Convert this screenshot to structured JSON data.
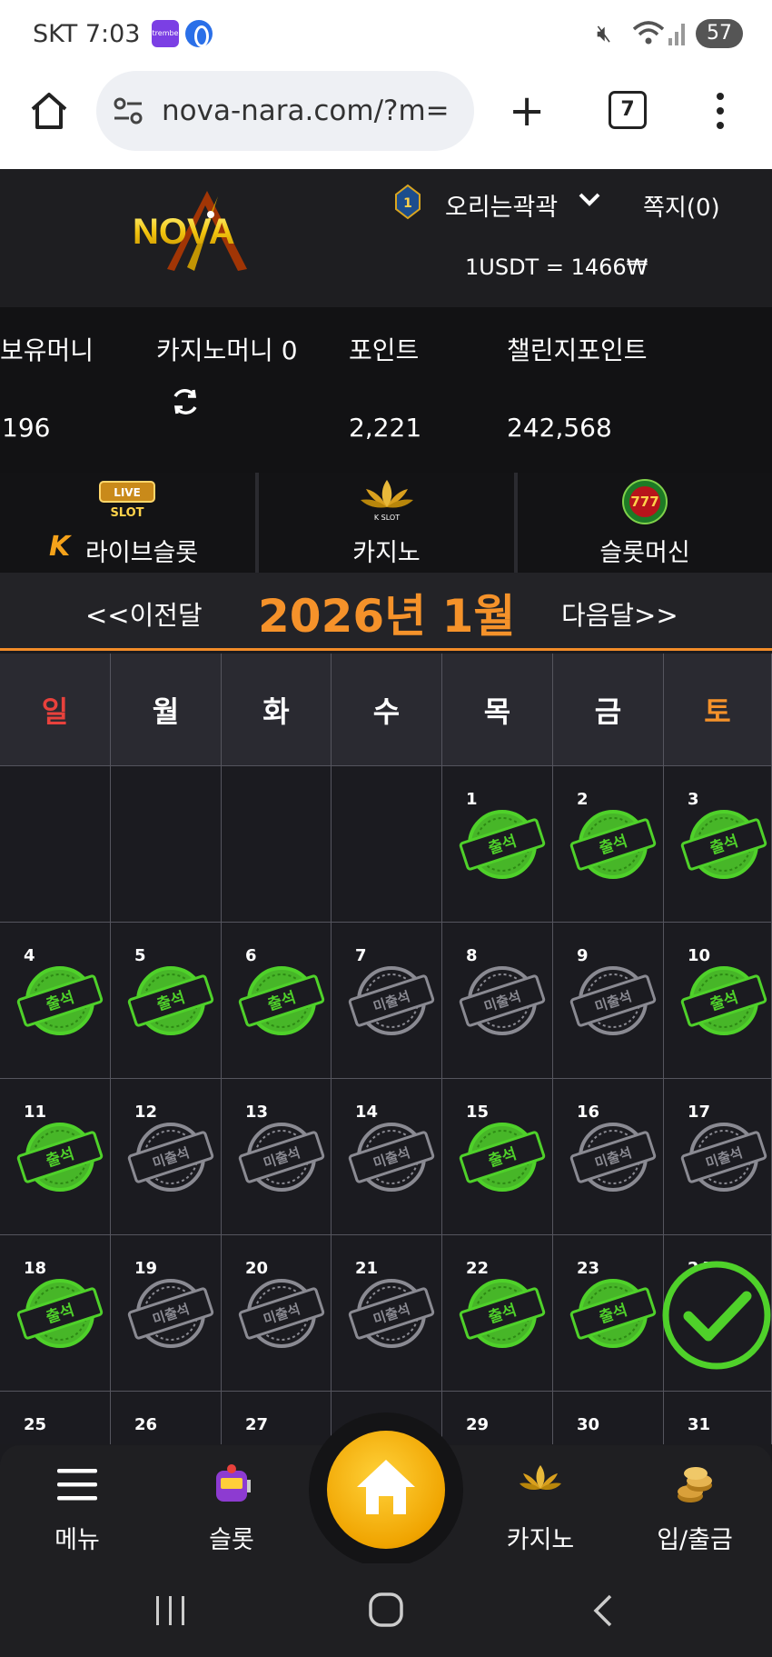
{
  "status_bar": {
    "carrier_time": "SKT 7:03",
    "app_icon_label": "trembe",
    "battery": "57"
  },
  "browser": {
    "url": "nova-nara.com/?m=",
    "tab_count": "7"
  },
  "header": {
    "logo_text": "NOVA",
    "level": "1",
    "username": "오리는곽곽",
    "messages": "쪽지(0)",
    "rate": "1USDT = 1466₩"
  },
  "balances": {
    "money_label": "보유머니",
    "money_value": "196",
    "casino_label": "카지노머니 0",
    "point_label": "포인트",
    "point_value": "2,221",
    "challenge_label": "챌린지포인트",
    "challenge_value": "242,568"
  },
  "categories": [
    {
      "label": "라이브슬롯",
      "icon": "live-slot-icon",
      "badge": "LIVE",
      "sub": "SLOT"
    },
    {
      "label": "카지노",
      "icon": "k-slot-lotus-icon",
      "sub": "K SLOT"
    },
    {
      "label": "슬롯머신",
      "icon": "777-slots-icon",
      "sub": "777"
    }
  ],
  "month_nav": {
    "prev": "<<이전달",
    "title": "2026년 1월",
    "next": "다음달>>"
  },
  "calendar": {
    "weekdays": [
      "일",
      "월",
      "화",
      "수",
      "목",
      "금",
      "토"
    ],
    "attended_label": "출석",
    "missed_label": "미출석",
    "days": [
      {
        "day": "",
        "status": "empty"
      },
      {
        "day": "",
        "status": "empty"
      },
      {
        "day": "",
        "status": "empty"
      },
      {
        "day": "",
        "status": "empty"
      },
      {
        "day": "1",
        "status": "attended"
      },
      {
        "day": "2",
        "status": "attended"
      },
      {
        "day": "3",
        "status": "attended"
      },
      {
        "day": "4",
        "status": "attended"
      },
      {
        "day": "5",
        "status": "attended"
      },
      {
        "day": "6",
        "status": "attended"
      },
      {
        "day": "7",
        "status": "missed"
      },
      {
        "day": "8",
        "status": "missed"
      },
      {
        "day": "9",
        "status": "missed"
      },
      {
        "day": "10",
        "status": "attended"
      },
      {
        "day": "11",
        "status": "attended"
      },
      {
        "day": "12",
        "status": "missed"
      },
      {
        "day": "13",
        "status": "missed"
      },
      {
        "day": "14",
        "status": "missed"
      },
      {
        "day": "15",
        "status": "attended"
      },
      {
        "day": "16",
        "status": "missed"
      },
      {
        "day": "17",
        "status": "missed"
      },
      {
        "day": "18",
        "status": "attended"
      },
      {
        "day": "19",
        "status": "missed"
      },
      {
        "day": "20",
        "status": "missed"
      },
      {
        "day": "21",
        "status": "missed"
      },
      {
        "day": "22",
        "status": "attended"
      },
      {
        "day": "23",
        "status": "attended"
      },
      {
        "day": "24",
        "status": "today-check"
      },
      {
        "day": "25",
        "status": "none"
      },
      {
        "day": "26",
        "status": "none"
      },
      {
        "day": "27",
        "status": "none"
      },
      {
        "day": "28",
        "status": "none"
      },
      {
        "day": "29",
        "status": "none"
      },
      {
        "day": "30",
        "status": "none"
      },
      {
        "day": "31",
        "status": "none"
      }
    ]
  },
  "bottom_nav": [
    {
      "label": "메뉴",
      "icon": "hamburger-icon"
    },
    {
      "label": "슬롯",
      "icon": "slot-machine-icon"
    },
    {
      "label": "",
      "icon": "home-icon"
    },
    {
      "label": "카지노",
      "icon": "k-slot-lotus-icon"
    },
    {
      "label": "입/출금",
      "icon": "coins-icon"
    }
  ],
  "colors": {
    "accent": "#f5922a",
    "attended_green": "#4fd12a",
    "missed_gray": "#8a8a92",
    "sunday_red": "#e8413c"
  }
}
